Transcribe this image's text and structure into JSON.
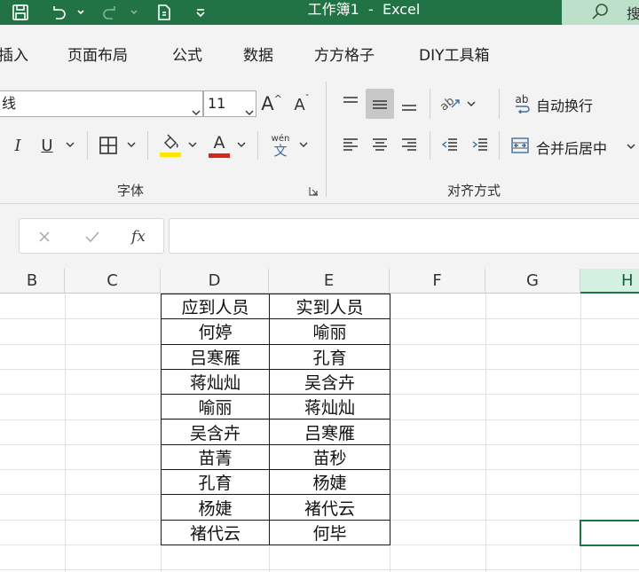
{
  "titlebar": {
    "title": "工作簿1  -  Excel",
    "search_label": "搜"
  },
  "tabs": [
    "插入",
    "页面布局",
    "公式",
    "数据",
    "方方格子",
    "DIY工具箱"
  ],
  "font": {
    "name": "线",
    "size": "11",
    "grow_label": "A",
    "shrink_label": "A",
    "italic": "I",
    "underline": "U",
    "font_color_label": "A",
    "phonetic_top": "wén",
    "phonetic_bottom": "文",
    "highlight_color": "#ffe600",
    "font_color": "#e0201b"
  },
  "alignment": {
    "orientation_label": "ab",
    "wrap_icon_label": "ab",
    "wrap_text": "自动换行",
    "merge_center": "合并后居中"
  },
  "groups": {
    "font_label": "字体",
    "align_label": "对齐方式"
  },
  "formula_bar": {
    "fx": "fx",
    "value": ""
  },
  "columns": [
    "B",
    "C",
    "D",
    "E",
    "F",
    "G",
    "H"
  ],
  "table": [
    [
      "应到人员",
      "实到人员"
    ],
    [
      "何婷",
      "喻丽"
    ],
    [
      "吕寒雁",
      "孔育"
    ],
    [
      "蒋灿灿",
      "吴含卉"
    ],
    [
      "喻丽",
      "蒋灿灿"
    ],
    [
      "吴含卉",
      "吕寒雁"
    ],
    [
      "苗菁",
      "苗秒"
    ],
    [
      "孔育",
      "杨婕"
    ],
    [
      "杨婕",
      "褚代云"
    ],
    [
      "褚代云",
      "何毕"
    ]
  ],
  "colors": {
    "accent": "#217346",
    "selected_header": "#d3f0e0"
  }
}
